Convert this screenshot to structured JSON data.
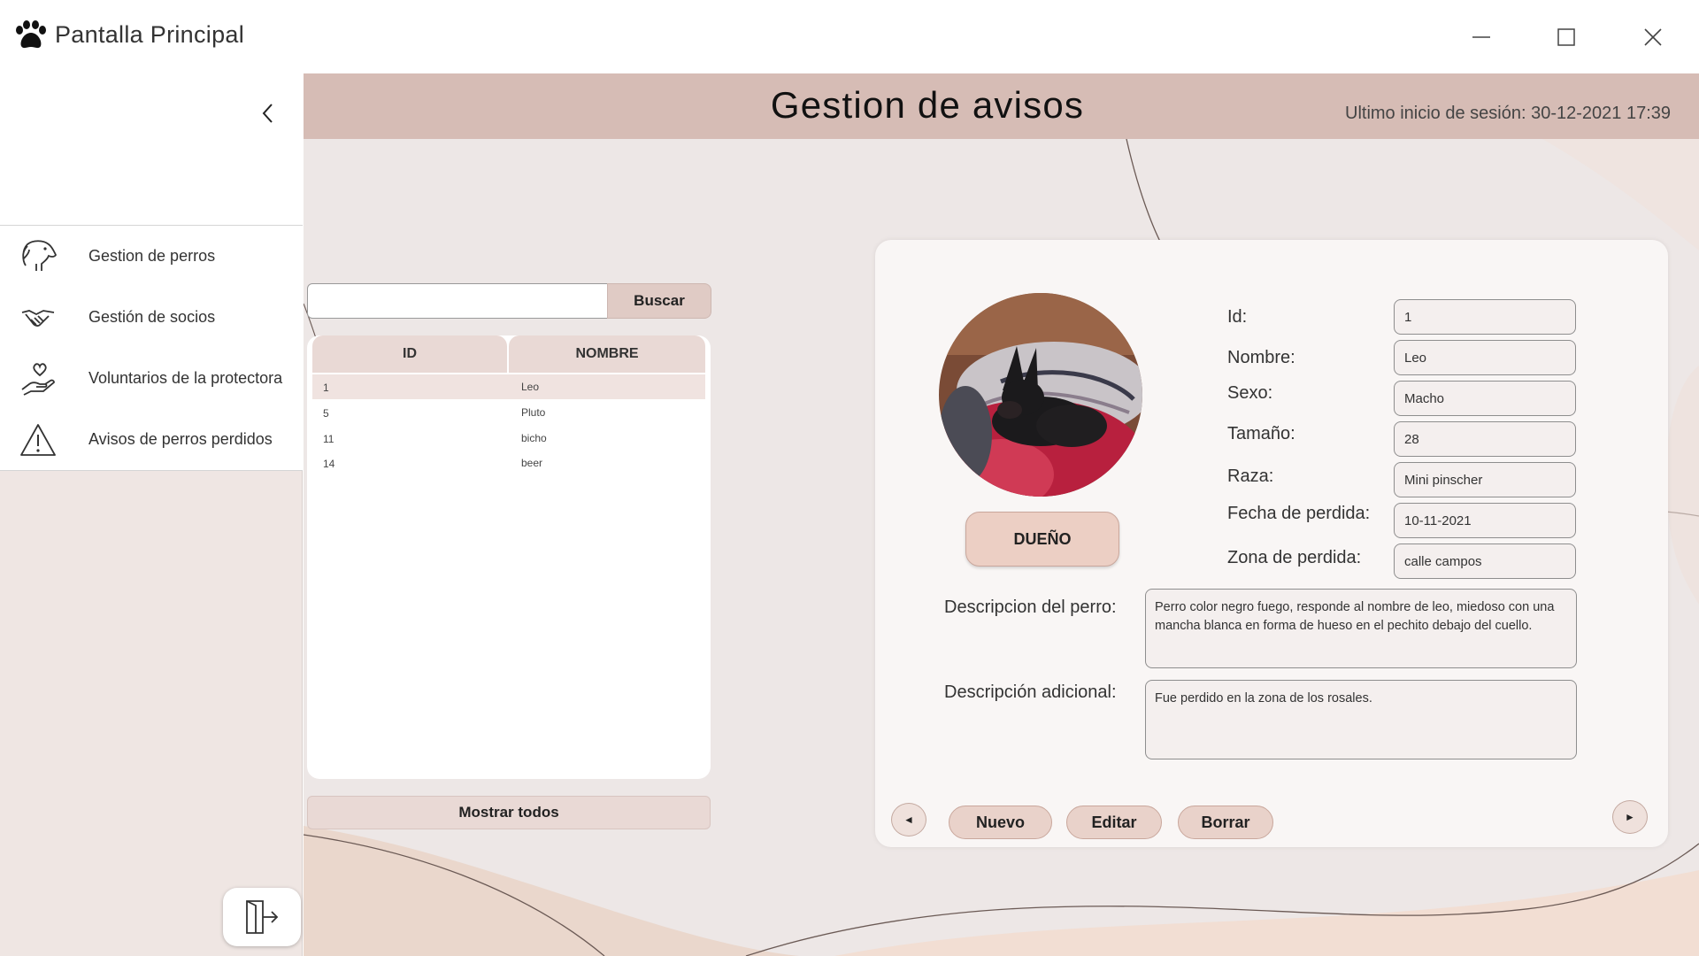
{
  "window": {
    "title": "Pantalla Principal",
    "app_icon": "paw-icon",
    "controls": [
      "minimize-icon",
      "maximize-icon",
      "close-icon"
    ]
  },
  "sidebar": {
    "collapse_icon": "chevron-left-icon",
    "items": [
      {
        "label": "Gestion de perros",
        "icon": "dog-icon"
      },
      {
        "label": "Gestión de socios",
        "icon": "handshake-icon"
      },
      {
        "label": "Voluntarios de la protectora",
        "icon": "heart-hand-icon"
      },
      {
        "label": "Avisos de perros perdidos",
        "icon": "warning-icon"
      }
    ],
    "logout_icon": "logout-icon"
  },
  "header": {
    "title": "Gestion de avisos",
    "last_login": "Ultimo inicio de sesión: 30-12-2021 17:39"
  },
  "search": {
    "value": "",
    "button_label": "Buscar"
  },
  "list": {
    "columns": [
      "ID",
      "NOMBRE"
    ],
    "rows": [
      {
        "id": "1",
        "name": "Leo"
      },
      {
        "id": "5",
        "name": "Pluto"
      },
      {
        "id": "11",
        "name": "bicho"
      },
      {
        "id": "14",
        "name": "beer"
      }
    ],
    "selected_index": 0,
    "show_all_label": "Mostrar todos"
  },
  "detail": {
    "owner_button": "DUEÑO",
    "fields": [
      {
        "label": "Id:",
        "value": "1"
      },
      {
        "label": "Nombre:",
        "value": "Leo"
      },
      {
        "label": "Sexo:",
        "value": "Macho"
      },
      {
        "label": "Tamaño:",
        "value": "28"
      },
      {
        "label": "Raza:",
        "value": "Mini pinscher"
      },
      {
        "label": "Fecha de perdida:",
        "value": "10-11-2021"
      },
      {
        "label": "Zona de perdida:",
        "value": "calle campos"
      }
    ],
    "description_label": "Descripcion del perro:",
    "description": "Perro color negro fuego, responde al nombre de leo, miedoso con una mancha blanca en forma de hueso en el pechito debajo del cuello.",
    "additional_label": "Descripción adicional:",
    "additional": "Fue perdido en la zona de los rosales."
  },
  "actions": {
    "prev": "◄",
    "next": "►",
    "new": "Nuevo",
    "edit": "Editar",
    "delete": "Borrar"
  },
  "colors": {
    "header_bg": "#d6bcb5",
    "main_bg": "#ede7e6",
    "sidebar_bg": "#efe6e3",
    "button_bg": "#e9d2ca"
  }
}
